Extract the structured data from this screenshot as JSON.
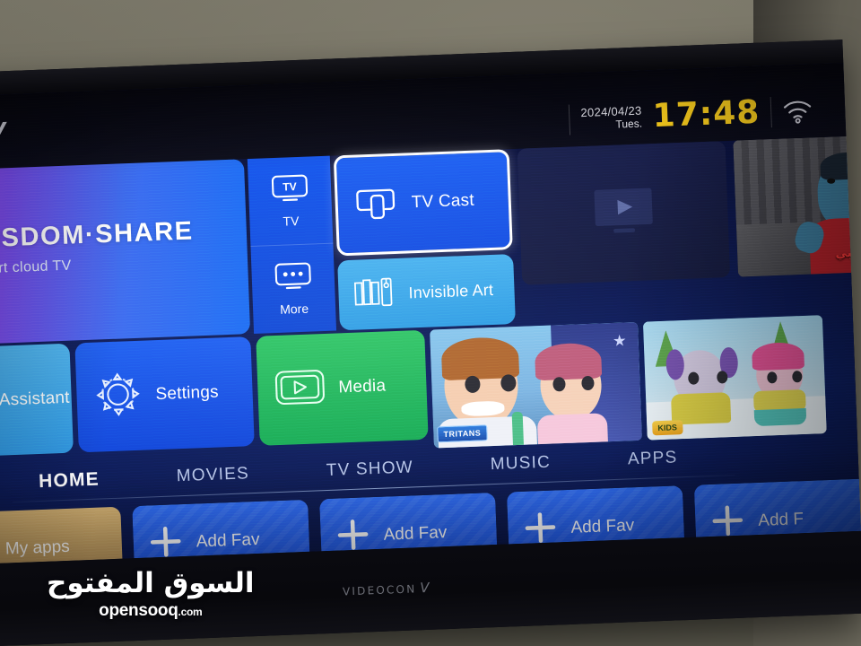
{
  "device": {
    "brand": "VIDEOCON",
    "brand_glyph": "V",
    "corner_logo": "v"
  },
  "status_bar": {
    "date": "2024/04/23",
    "weekday": "Tues.",
    "time": "17:48",
    "time_color": "#ffd21e",
    "wifi_icon": "wifi-icon"
  },
  "hero": {
    "title": "WISDOM·SHARE",
    "subtitle": "Smart cloud TV"
  },
  "source_column": [
    {
      "label": "TV",
      "icon": "tv-monitor-icon"
    },
    {
      "label": "More",
      "icon": "more-dots-monitor-icon"
    }
  ],
  "feature_tiles": [
    {
      "label": "TV Cast",
      "icon": "cast-screen-icon",
      "focused": true,
      "color": "#1f62f3"
    },
    {
      "label": "Invisible Art",
      "icon": "art-frames-icon",
      "focused": false,
      "color": "#4ab4f0"
    }
  ],
  "action_tiles": [
    {
      "label": "TV Assistant",
      "icon": "assistant-icon",
      "color": "#4fb7f2"
    },
    {
      "label": "Settings",
      "icon": "gear-icon",
      "color": "#1f61f2"
    },
    {
      "label": "Media",
      "icon": "media-play-icon",
      "color": "#2fc667"
    }
  ],
  "media_cards": [
    {
      "name": "video-placeholder-card",
      "icon": "video-placeholder-icon",
      "caption": ""
    },
    {
      "name": "movie-card",
      "caption": "م يا صحبي",
      "caption_color": "#ff3a3a"
    },
    {
      "name": "kids-card-1",
      "badge": "TRITANS"
    },
    {
      "name": "kids-card-2",
      "badge": "KIDS"
    }
  ],
  "nav_tabs": [
    {
      "label": "HOME",
      "active": true
    },
    {
      "label": "MOVIES",
      "active": false
    },
    {
      "label": "TV SHOW",
      "active": false
    },
    {
      "label": "MUSIC",
      "active": false
    },
    {
      "label": "APPS",
      "active": false
    }
  ],
  "favorites": [
    {
      "label": "My apps",
      "icon": "apps-grid-icon",
      "type": "myapps"
    },
    {
      "label": "Add Fav",
      "icon": "plus-icon",
      "type": "add"
    },
    {
      "label": "Add Fav",
      "icon": "plus-icon",
      "type": "add"
    },
    {
      "label": "Add Fav",
      "icon": "plus-icon",
      "type": "add"
    },
    {
      "label": "Add F",
      "icon": "plus-icon",
      "type": "add"
    }
  ],
  "watermark": {
    "arabic": "السوق المفتوح",
    "latin": "opensooq",
    "suffix": ".com"
  }
}
